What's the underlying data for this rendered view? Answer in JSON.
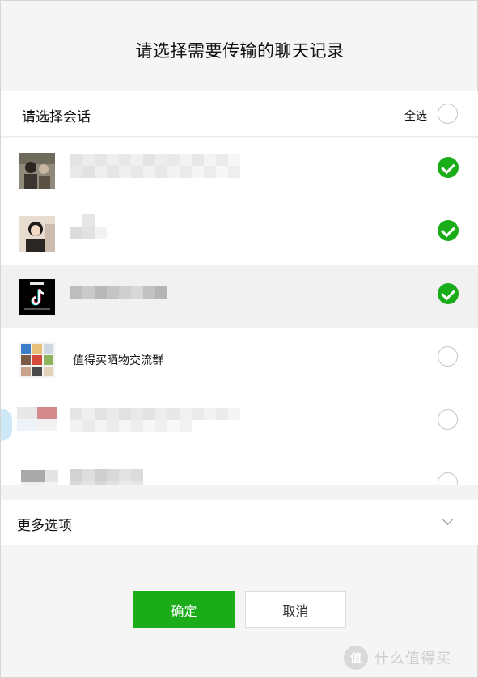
{
  "dialog": {
    "title": "请选择需要传输的聊天记录"
  },
  "session_header": {
    "label": "请选择会话",
    "select_all_label": "全选",
    "select_all_checked": false
  },
  "conversations": [
    {
      "name": "",
      "checked": true
    },
    {
      "name": "",
      "checked": true
    },
    {
      "name": "",
      "checked": true
    },
    {
      "name": "值得买晒物交流群",
      "checked": false
    },
    {
      "name": "",
      "checked": false
    },
    {
      "name": "",
      "checked": false
    }
  ],
  "more_options": {
    "label": "更多选项"
  },
  "buttons": {
    "confirm_label": "确定",
    "cancel_label": "取消"
  },
  "colors": {
    "accent": "#1aad19",
    "highlight_row": "#f1f1f1"
  },
  "watermark": {
    "logo_text": "值",
    "text": "什么值得买"
  }
}
